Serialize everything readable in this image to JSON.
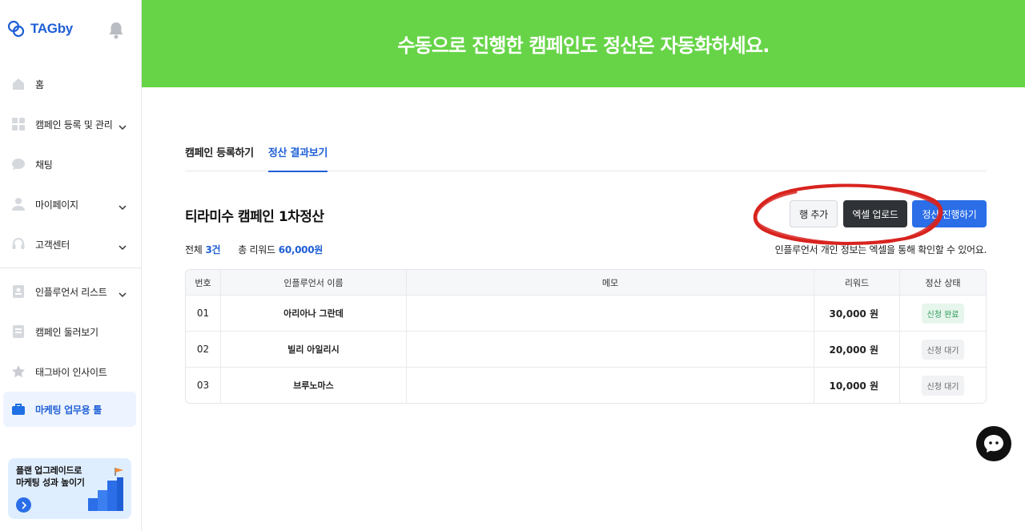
{
  "brand": {
    "name": "TAGby"
  },
  "sidebar": {
    "items": [
      {
        "label": "홈",
        "icon": "home-icon"
      },
      {
        "label": "캠페인 등록 및 관리",
        "icon": "grid-icon",
        "expandable": true
      },
      {
        "label": "채팅",
        "icon": "chat-bubble-icon"
      },
      {
        "label": "마이페이지",
        "icon": "user-icon",
        "expandable": true
      },
      {
        "label": "고객센터",
        "icon": "headset-icon",
        "expandable": true
      },
      {
        "label": "인플루언서 리스트",
        "icon": "profile-card-icon",
        "expandable": true
      },
      {
        "label": "캠페인 둘러보기",
        "icon": "document-icon"
      },
      {
        "label": "태그바이 인사이트",
        "icon": "star-icon"
      },
      {
        "label": "마케팅 업무용 툴",
        "icon": "briefcase-icon",
        "active": true
      }
    ],
    "promo": {
      "line1": "플랜 업그레이드로",
      "line2": "마케팅 성과 높이기"
    }
  },
  "banner": {
    "text": "수동으로 진행한 캠페인도 정산은 자동화하세요."
  },
  "tabs": [
    {
      "label": "캠페인 등록하기",
      "active": false
    },
    {
      "label": "정산 결과보기",
      "active": true
    }
  ],
  "section": {
    "title": "티라미수 캠페인 1차정산",
    "buttons": {
      "add_row": "행 추가",
      "excel_upload": "엑셀 업로드",
      "settle": "정산 진행하기"
    },
    "summary": {
      "total_label": "전체",
      "total_count": "3건",
      "reward_label": "총 리워드",
      "reward_total": "60,000원"
    },
    "notice": "인플루언서 개인 정보는 엑셀을 통해 확인할 수 있어요."
  },
  "table": {
    "headers": [
      "번호",
      "인플루언서 이름",
      "메모",
      "리워드",
      "정산 상태"
    ],
    "rows": [
      {
        "no": "01",
        "name": "아리아나 그란데",
        "memo": "",
        "reward": "30,000 원",
        "status": "신청 완료",
        "status_type": "done"
      },
      {
        "no": "02",
        "name": "빌리 아일리시",
        "memo": "",
        "reward": "20,000 원",
        "status": "신청 대기",
        "status_type": "wait"
      },
      {
        "no": "03",
        "name": "브루노마스",
        "memo": "",
        "reward": "10,000 원",
        "status": "신청 대기",
        "status_type": "wait"
      }
    ]
  },
  "colors": {
    "banner": "#67d448",
    "accent": "#1f5fd6",
    "annotation": "#d8231e"
  }
}
